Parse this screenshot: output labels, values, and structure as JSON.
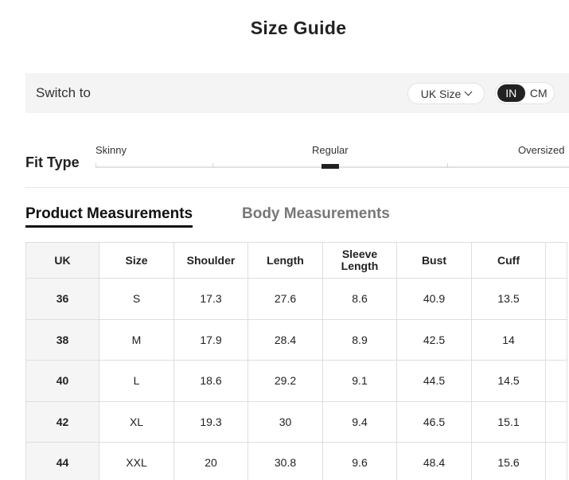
{
  "title": "Size Guide",
  "switch": {
    "label": "Switch to",
    "size_system": "UK Size",
    "units": [
      "IN",
      "CM"
    ],
    "active_unit": "IN"
  },
  "fit_type": {
    "label": "Fit Type",
    "options": [
      "Skinny",
      "Regular",
      "Oversized"
    ],
    "selected": "Regular"
  },
  "tabs": [
    {
      "label": "Product Measurements",
      "active": true
    },
    {
      "label": "Body Measurements",
      "active": false
    }
  ],
  "table": {
    "headers": [
      "UK",
      "Size",
      "Shoulder",
      "Length",
      "Sleeve Length",
      "Bust",
      "Cuff",
      ""
    ],
    "rows": [
      [
        "36",
        "S",
        "17.3",
        "27.6",
        "8.6",
        "40.9",
        "13.5",
        ""
      ],
      [
        "38",
        "M",
        "17.9",
        "28.4",
        "8.9",
        "42.5",
        "14",
        ""
      ],
      [
        "40",
        "L",
        "18.6",
        "29.2",
        "9.1",
        "44.5",
        "14.5",
        ""
      ],
      [
        "42",
        "XL",
        "19.3",
        "30",
        "9.4",
        "46.5",
        "15.1",
        ""
      ],
      [
        "44",
        "XXL",
        "20",
        "30.8",
        "9.6",
        "48.4",
        "15.6",
        ""
      ]
    ]
  }
}
